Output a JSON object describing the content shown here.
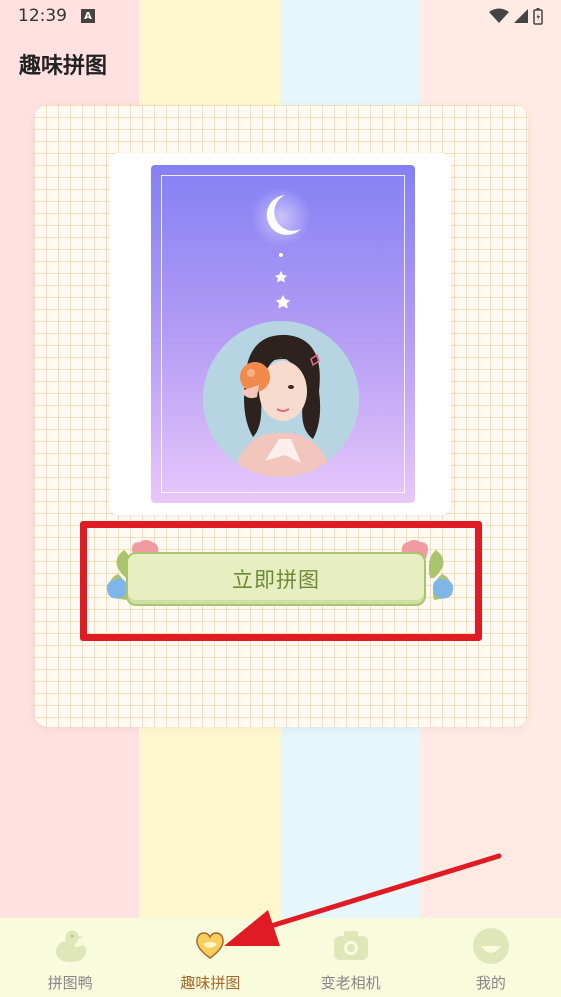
{
  "status_bar": {
    "time": "12:39",
    "notif_letter": "A"
  },
  "header": {
    "title": "趣味拼图"
  },
  "main": {
    "start_button_label": "立即拼图"
  },
  "tabs": [
    {
      "label": "拼图鸭",
      "icon": "duck-icon",
      "active": false
    },
    {
      "label": "趣味拼图",
      "icon": "heart-icon",
      "active": true
    },
    {
      "label": "变老相机",
      "icon": "camera-icon",
      "active": false
    },
    {
      "label": "我的",
      "icon": "smile-icon",
      "active": false
    }
  ],
  "colors": {
    "highlight_box": "#e01b24",
    "arrow": "#e01b24",
    "active_tab": "#a7672f",
    "tab_bar": "#f8fbdc",
    "button_text": "#6e8a36"
  }
}
